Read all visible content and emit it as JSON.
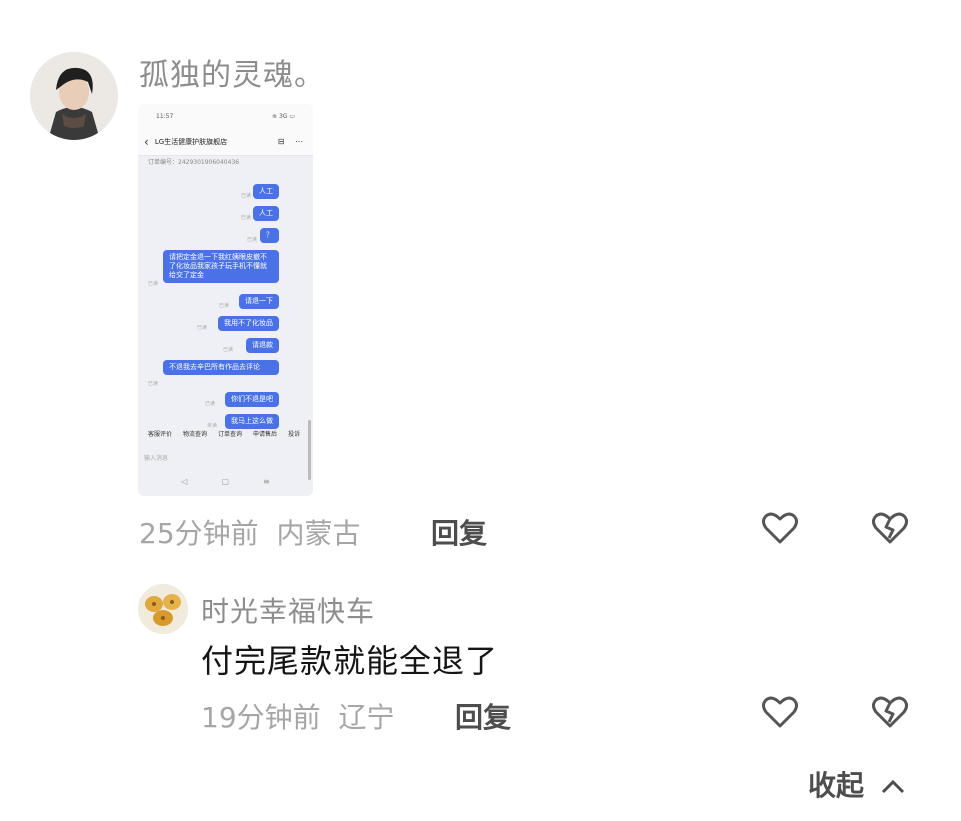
{
  "comment": {
    "username": "孤独的灵魂。",
    "time": "25分钟前",
    "location": "内蒙古",
    "reply_label": "回复",
    "like_icon": "heart-outline-icon",
    "dislike_icon": "broken-heart-icon",
    "screenshot": {
      "status_time": "11:57",
      "status_right": "≋ 3G ▭",
      "store_name": "LG生活健康护肤旗舰店",
      "order_label": "订单编号：2429301906040436",
      "messages": [
        "人工",
        "人工",
        "？",
        "请把定金退一下我红姨眼皮撤不了化妆品我家孩子玩手机不懂就给交了定金",
        "请退一下",
        "我用不了化妆品",
        "请退款",
        "不退我去辛巴所有作品去评论",
        "你们不退是吧",
        "我马上这么做"
      ],
      "read_marks": [
        "已读",
        "已读",
        "已读",
        "已读",
        "已读",
        "已读",
        "已读",
        "已读",
        "已读",
        "未读"
      ],
      "menu": [
        "客服评价",
        "物流查询",
        "订单查询",
        "申请售后",
        "投诉"
      ],
      "input_placeholder": "输入消息",
      "nav": [
        "◁",
        "▢",
        "≡"
      ]
    }
  },
  "reply": {
    "username": "时光幸福快车",
    "content": "付完尾款就能全退了",
    "time": "19分钟前",
    "location": "辽宁",
    "reply_label": "回复"
  },
  "collapse_label": "收起",
  "collapse_icon": "chevron-up-icon"
}
